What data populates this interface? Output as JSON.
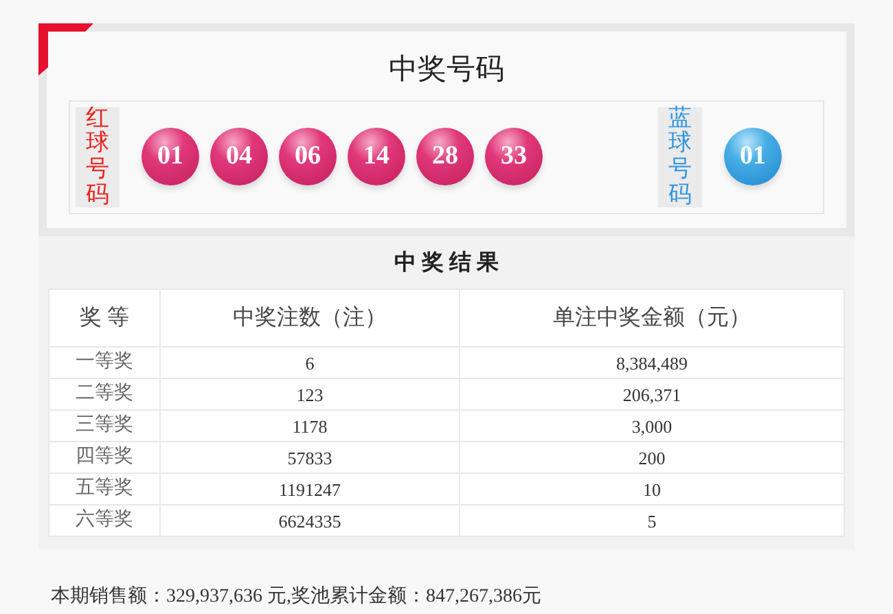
{
  "title": "中奖号码",
  "red_label": "红球号码",
  "red_balls": [
    "01",
    "04",
    "06",
    "14",
    "28",
    "33"
  ],
  "blue_label": "蓝球号码",
  "blue_balls": [
    "01"
  ],
  "results_title": "中 奖 结 果",
  "table": {
    "columns": [
      "奖 等",
      "中奖注数（注）",
      "单注中奖金额（元）"
    ],
    "rows": [
      [
        "一等奖",
        "6",
        "8,384,489"
      ],
      [
        "二等奖",
        "123",
        "206,371"
      ],
      [
        "三等奖",
        "1178",
        "3,000"
      ],
      [
        "四等奖",
        "57833",
        "200"
      ],
      [
        "五等奖",
        "1191247",
        "10"
      ],
      [
        "六等奖",
        "6624335",
        "5"
      ]
    ]
  },
  "summary": "本期销售额：329,937,636 元,奖池累计金额：847,267,386元"
}
